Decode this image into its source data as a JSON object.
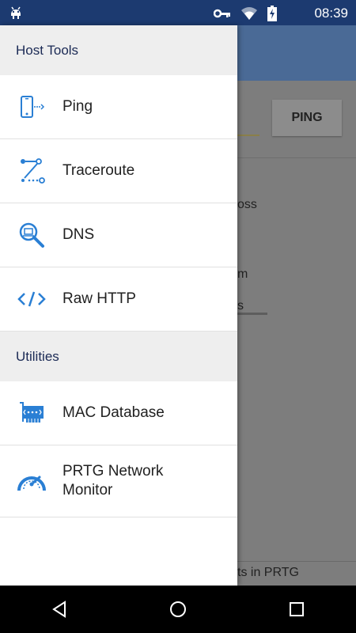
{
  "status_bar": {
    "time": "08:39"
  },
  "background": {
    "ping_button": "PING",
    "snippets": [
      "oss",
      "m",
      "s"
    ],
    "footer_text": "ts in PRTG"
  },
  "drawer": {
    "sections": [
      {
        "header": "Host Tools",
        "items": [
          {
            "label": "Ping",
            "icon": "ping-icon"
          },
          {
            "label": "Traceroute",
            "icon": "traceroute-icon"
          },
          {
            "label": "DNS",
            "icon": "dns-icon"
          },
          {
            "label": "Raw HTTP",
            "icon": "code-icon"
          }
        ]
      },
      {
        "header": "Utilities",
        "items": [
          {
            "label": "MAC Database",
            "icon": "network-card-icon"
          },
          {
            "label": "PRTG Network Monitor",
            "icon": "gauge-icon"
          }
        ]
      }
    ]
  },
  "colors": {
    "status_bar": "#1c3a70",
    "icon_blue": "#2a7fd4",
    "section_text": "#1b2a55"
  }
}
